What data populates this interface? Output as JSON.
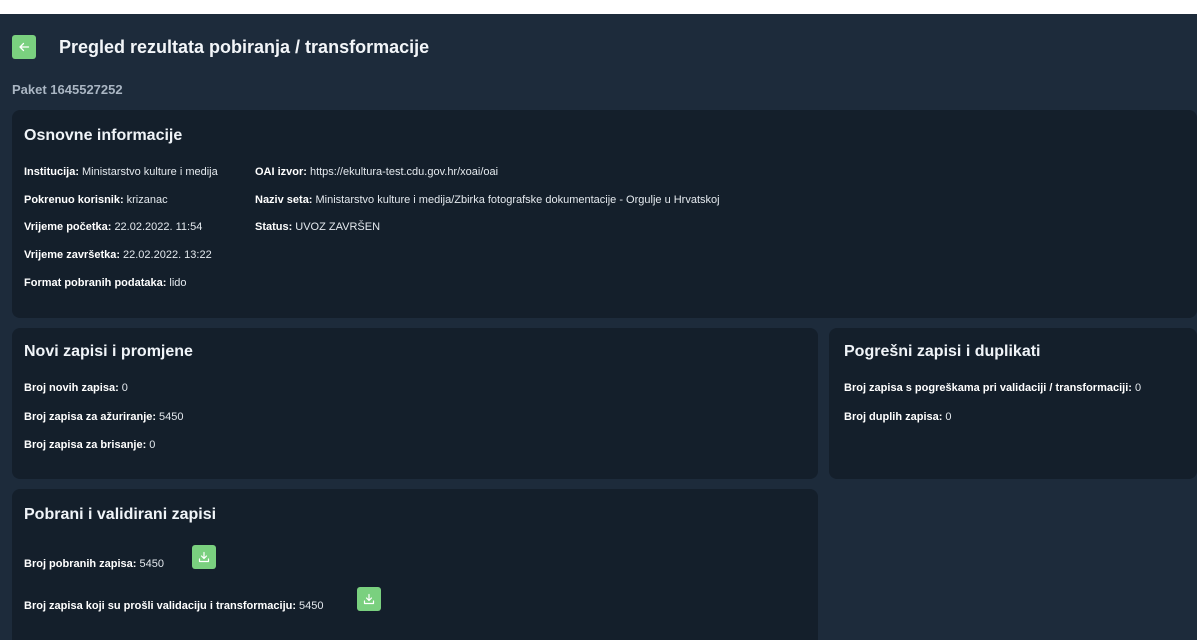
{
  "header": {
    "title": "Pregled rezultata pobiranja / transformacije",
    "subtitle": "Paket 1645527252"
  },
  "basic_info": {
    "title": "Osnovne informacije",
    "institution_label": "Institucija:",
    "institution_value": "Ministarstvo kulture i medija",
    "user_label": "Pokrenuo korisnik:",
    "user_value": "krizanac",
    "start_label": "Vrijeme početka:",
    "start_value": "22.02.2022. 11:54",
    "end_label": "Vrijeme završetka:",
    "end_value": "22.02.2022. 13:22",
    "format_label": "Format pobranih podataka:",
    "format_value": "lido",
    "oai_label": "OAI izvor:",
    "oai_value": "https://ekultura-test.cdu.gov.hr/xoai/oai",
    "set_label": "Naziv seta:",
    "set_value": "Ministarstvo kulture i medija/Zbirka fotografske dokumentacije - Orgulje u Hrvatskoj",
    "status_label": "Status:",
    "status_value": "UVOZ ZAVRŠEN"
  },
  "new_records": {
    "title": "Novi zapisi i promjene",
    "new_label": "Broj novih zapisa:",
    "new_value": "0",
    "update_label": "Broj zapisa za ažuriranje:",
    "update_value": "5450",
    "delete_label": "Broj zapisa za brisanje:",
    "delete_value": "0"
  },
  "errors": {
    "title": "Pogrešni zapisi i duplikati",
    "invalid_label": "Broj zapisa s pogreškama pri validaciji / transformaciji:",
    "invalid_value": "0",
    "duplicate_label": "Broj duplih zapisa:",
    "duplicate_value": "0"
  },
  "harvested": {
    "title": "Pobrani i validirani zapisi",
    "harvested_label": "Broj pobranih zapisa:",
    "harvested_value": "5450",
    "validated_label": "Broj zapisa koji su prošli validaciju i transformaciju:",
    "validated_value": "5450"
  },
  "icons": {
    "back": "arrow-left-icon",
    "download": "download-icon"
  },
  "colors": {
    "background": "#1d2b3b",
    "card": "#141f2b",
    "accent": "#7ad07f"
  }
}
